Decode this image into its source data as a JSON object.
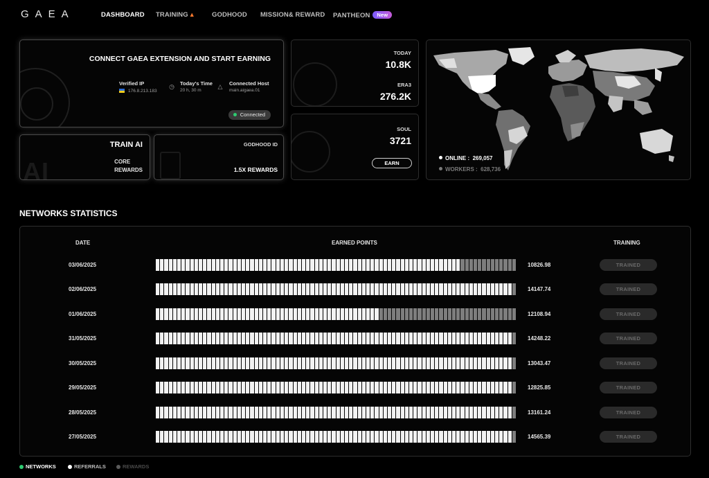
{
  "nav": {
    "logo": "GAEA",
    "items": [
      {
        "label": "DASHBOARD"
      },
      {
        "label": "TRAINING"
      },
      {
        "label": "GODHOOD"
      },
      {
        "label": "MISSION& REWARD"
      },
      {
        "label": "PANTHEON"
      }
    ],
    "new_badge": "New"
  },
  "connect": {
    "title": "CONNECT GAEA EXTENSION AND START EARNING",
    "verified_ip_label": "Verified IP",
    "verified_ip_value": "176.8.213.183",
    "todays_time_label": "Today's Time",
    "todays_time_value": "20 h, 30 m",
    "connected_host_label": "Connected Host",
    "connected_host_value": "main.aigaea.01",
    "status": "Connected"
  },
  "train": {
    "title": "TRAIN AI",
    "line1": "CORE",
    "line2": "REWARDS",
    "deco": "AI"
  },
  "godhood": {
    "title": "GODHOOD ID",
    "value": "1.5X REWARDS"
  },
  "stats": {
    "today_label": "TODAY",
    "today_value": "10.8K",
    "era_label": "ERA3",
    "era_value": "276.2K",
    "soul_label": "SOUL",
    "soul_value": "3721",
    "earn_label": "EARN"
  },
  "map": {
    "online_label": "ONLINE :",
    "online_value": "269,057",
    "workers_label": "WORKERS :",
    "workers_value": "628,736"
  },
  "networks": {
    "title": "NETWORKS STATISTICS",
    "headers": {
      "date": "DATE",
      "points": "EARNED POINTS",
      "training": "TRAINING"
    },
    "rows": [
      {
        "date": "03/06/2025",
        "points": "10826.98",
        "status": "TRAINED",
        "fill": 0.84
      },
      {
        "date": "02/06/2025",
        "points": "14147.74",
        "status": "TRAINED",
        "fill": 0.99
      },
      {
        "date": "01/06/2025",
        "points": "12108.94",
        "status": "TRAINED",
        "fill": 0.62
      },
      {
        "date": "31/05/2025",
        "points": "14248.22",
        "status": "TRAINED",
        "fill": 0.99
      },
      {
        "date": "30/05/2025",
        "points": "13043.47",
        "status": "TRAINED",
        "fill": 0.99
      },
      {
        "date": "29/05/2025",
        "points": "12825.85",
        "status": "TRAINED",
        "fill": 0.99
      },
      {
        "date": "28/05/2025",
        "points": "13161.24",
        "status": "TRAINED",
        "fill": 0.99
      },
      {
        "date": "27/05/2025",
        "points": "14565.39",
        "status": "TRAINED",
        "fill": 0.99
      }
    ]
  },
  "footer_tabs": [
    {
      "label": "NETWORKS",
      "color": "#2ecc71"
    },
    {
      "label": "REFERRALS",
      "color": "#ffffff"
    },
    {
      "label": "REWARDS",
      "color": "#5a5a5a"
    }
  ]
}
